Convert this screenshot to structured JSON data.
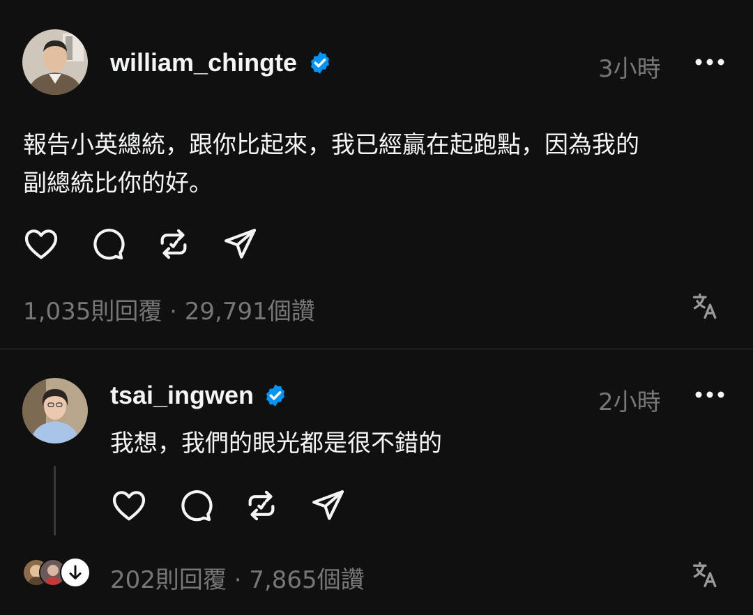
{
  "posts": [
    {
      "username": "william_chingte",
      "verified": true,
      "time": "3小時",
      "text_lines": [
        "報告小英總統，跟你比起來，我已經贏在起跑點，因為我的",
        "副總統比你的好。"
      ],
      "stats": "1,035則回覆 · 29,791個讚",
      "icons": [
        "heart-icon",
        "comment-icon",
        "repost-icon",
        "share-icon",
        "translate-icon",
        "more-icon"
      ]
    },
    {
      "username": "tsai_ingwen",
      "verified": true,
      "time": "2小時",
      "text_lines": [
        "我想，我們的眼光都是很不錯的"
      ],
      "stats": "202則回覆 · 7,865個讚",
      "icons": [
        "heart-icon",
        "comment-icon",
        "repost-icon",
        "share-icon",
        "translate-icon",
        "more-icon",
        "arrow-down-icon"
      ]
    }
  ],
  "colors": {
    "background": "#101010",
    "text": "#f3f5f7",
    "muted": "#777777",
    "verified_blue": "#0095f6",
    "divider": "#333638"
  }
}
